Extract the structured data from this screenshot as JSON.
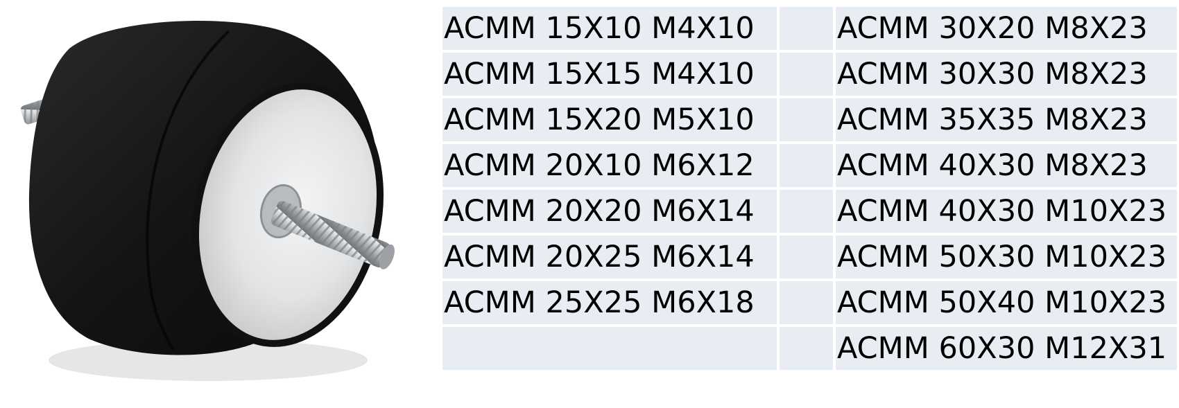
{
  "colors": {
    "cell_background": "#e8edf4",
    "text": "#000000",
    "rubber": "#1c1c1c",
    "metal": "#c8ccd0"
  },
  "image": {
    "icon": "rubber-anti-vibration-mount-icon"
  },
  "table": {
    "left_column": [
      "ACMM 15X10 M4X10",
      "ACMM 15X15 M4X10",
      "ACMM 15X20 M5X10",
      "ACMM 20X10 M6X12",
      "ACMM 20X20 M6X14",
      "ACMM 20X25 M6X14",
      "ACMM 25X25 M6X18",
      ""
    ],
    "right_column": [
      "ACMM 30X20 M8X23",
      "ACMM 30X30 M8X23",
      "ACMM 35X35 M8X23",
      "ACMM 40X30 M8X23",
      "ACMM 40X30 M10X23",
      "ACMM 50X30 M10X23",
      "ACMM 50X40 M10X23",
      "ACMM 60X30 M12X31"
    ]
  }
}
